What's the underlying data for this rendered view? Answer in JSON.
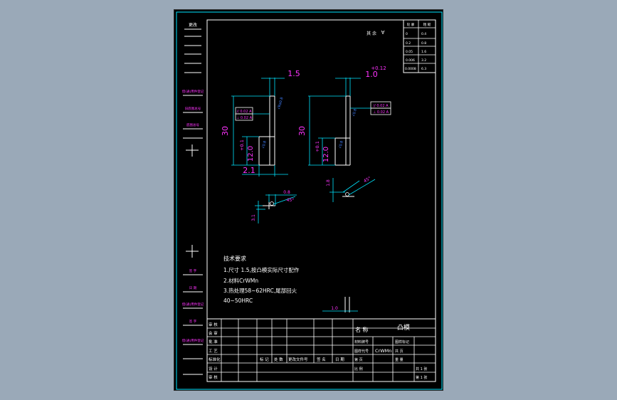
{
  "colors": {
    "frame": "#ffffff",
    "cyan": "#00e5ff",
    "magenta": "#ff33ff",
    "yellow": "#ffff66",
    "blue": "#3f7fff",
    "gray": "#a0a0a0",
    "background": "#000000",
    "canvas": "#9aa9b8"
  },
  "left_strip": {
    "header": "更改",
    "labels": [
      "借(通)用件登记",
      "旧底图总号",
      "底图总号",
      "签 字",
      "日 期",
      "借(通)用件登记",
      "签 字"
    ]
  },
  "roughness_table": {
    "note": "其 余",
    "rows": [
      [
        "0",
        "0.4"
      ],
      [
        "0.2",
        "0.8"
      ],
      [
        "0.05",
        "1.6"
      ],
      [
        "0.006",
        "3.2"
      ],
      [
        "0.0008",
        "6.3"
      ]
    ]
  },
  "dims": {
    "top_left": "1.5",
    "top_right": "1.0",
    "tol_top": "+0.12",
    "height_left": "30",
    "height_right": "30",
    "tol_left": "+0.1",
    "tol_right": "+0.1",
    "sub_left": "12.0",
    "sub_right": "12.0",
    "bottom_left": "2.1",
    "gdt_left_1": "// 0.02 A",
    "gdt_left_2": "⊥ 0.02 A",
    "gdt_right_1": "// 0.02 A",
    "gdt_right_2": "⊥ 0.02 A",
    "detail_a_top": "0.8",
    "detail_a_angle": "45°",
    "detail_a_side": "3.1",
    "detail_b_side": "1.8",
    "detail_b_angle": "45°",
    "bottom_small": "1.0"
  },
  "notes": {
    "title": "技术要求",
    "lines": [
      "1.尺寸 1.5,按凸模实际尺寸配作",
      "2.材料CrWMn",
      "3.热处理58~62HRC,尾部回火",
      "40~50HRC"
    ]
  },
  "title_block": {
    "rows_left": [
      "审 核",
      "会 审",
      "批 准",
      "工 艺",
      "标准化",
      "设 计",
      "审 核"
    ],
    "bottom_row": [
      "标 记",
      "处 数",
      "更改文件号",
      "签 名",
      "日 期"
    ],
    "name_label": "名 称",
    "part_name": "凸模",
    "material_label": "材料牌号",
    "material": "CrWMn",
    "right_labels": [
      "图样代号",
      "图样标记",
      "共 页",
      "第 页"
    ],
    "small_labels": [
      "重 量",
      "比 例",
      "共 1 张",
      "第 1 张"
    ]
  }
}
